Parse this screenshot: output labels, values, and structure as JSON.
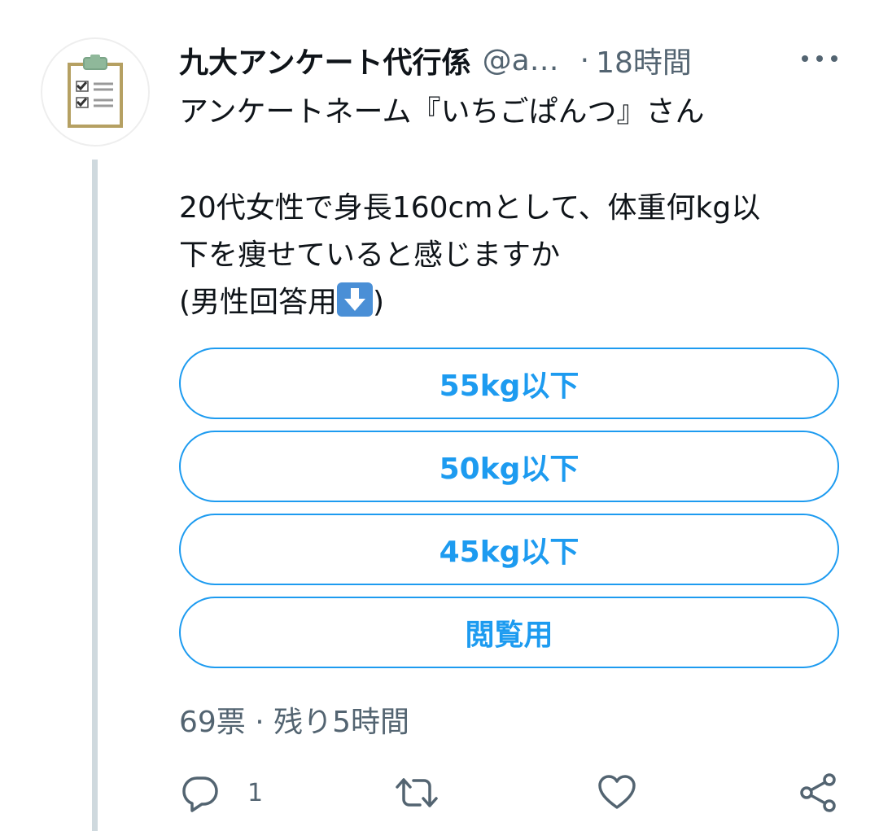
{
  "author": {
    "display_name": "九大アンケート代行係",
    "handle": "@a…",
    "separator": "·",
    "time": "18時間"
  },
  "body": {
    "line1": "アンケートネーム『いちごぱんつ』さん",
    "line2": "20代女性で身長160cmとして、体重何kg以",
    "line3": "下を痩せていると感じますか",
    "line4_text": "(男性回答用",
    "line4_close": ")",
    "emoji": "down-arrow-emoji"
  },
  "poll": {
    "options": [
      {
        "label": "55kg以下"
      },
      {
        "label": "50kg以下"
      },
      {
        "label": "45kg以下"
      },
      {
        "label": "閲覧用"
      }
    ],
    "meta": "69票 · 残り5時間"
  },
  "actions": {
    "reply_count": "1",
    "icons": [
      "reply-icon",
      "retweet-icon",
      "like-icon",
      "share-icon"
    ]
  },
  "colors": {
    "accent": "#1d9bf0",
    "secondary_text": "#536471",
    "thread_line": "#cfd9de",
    "emoji_bg": "#4a8fd6"
  }
}
